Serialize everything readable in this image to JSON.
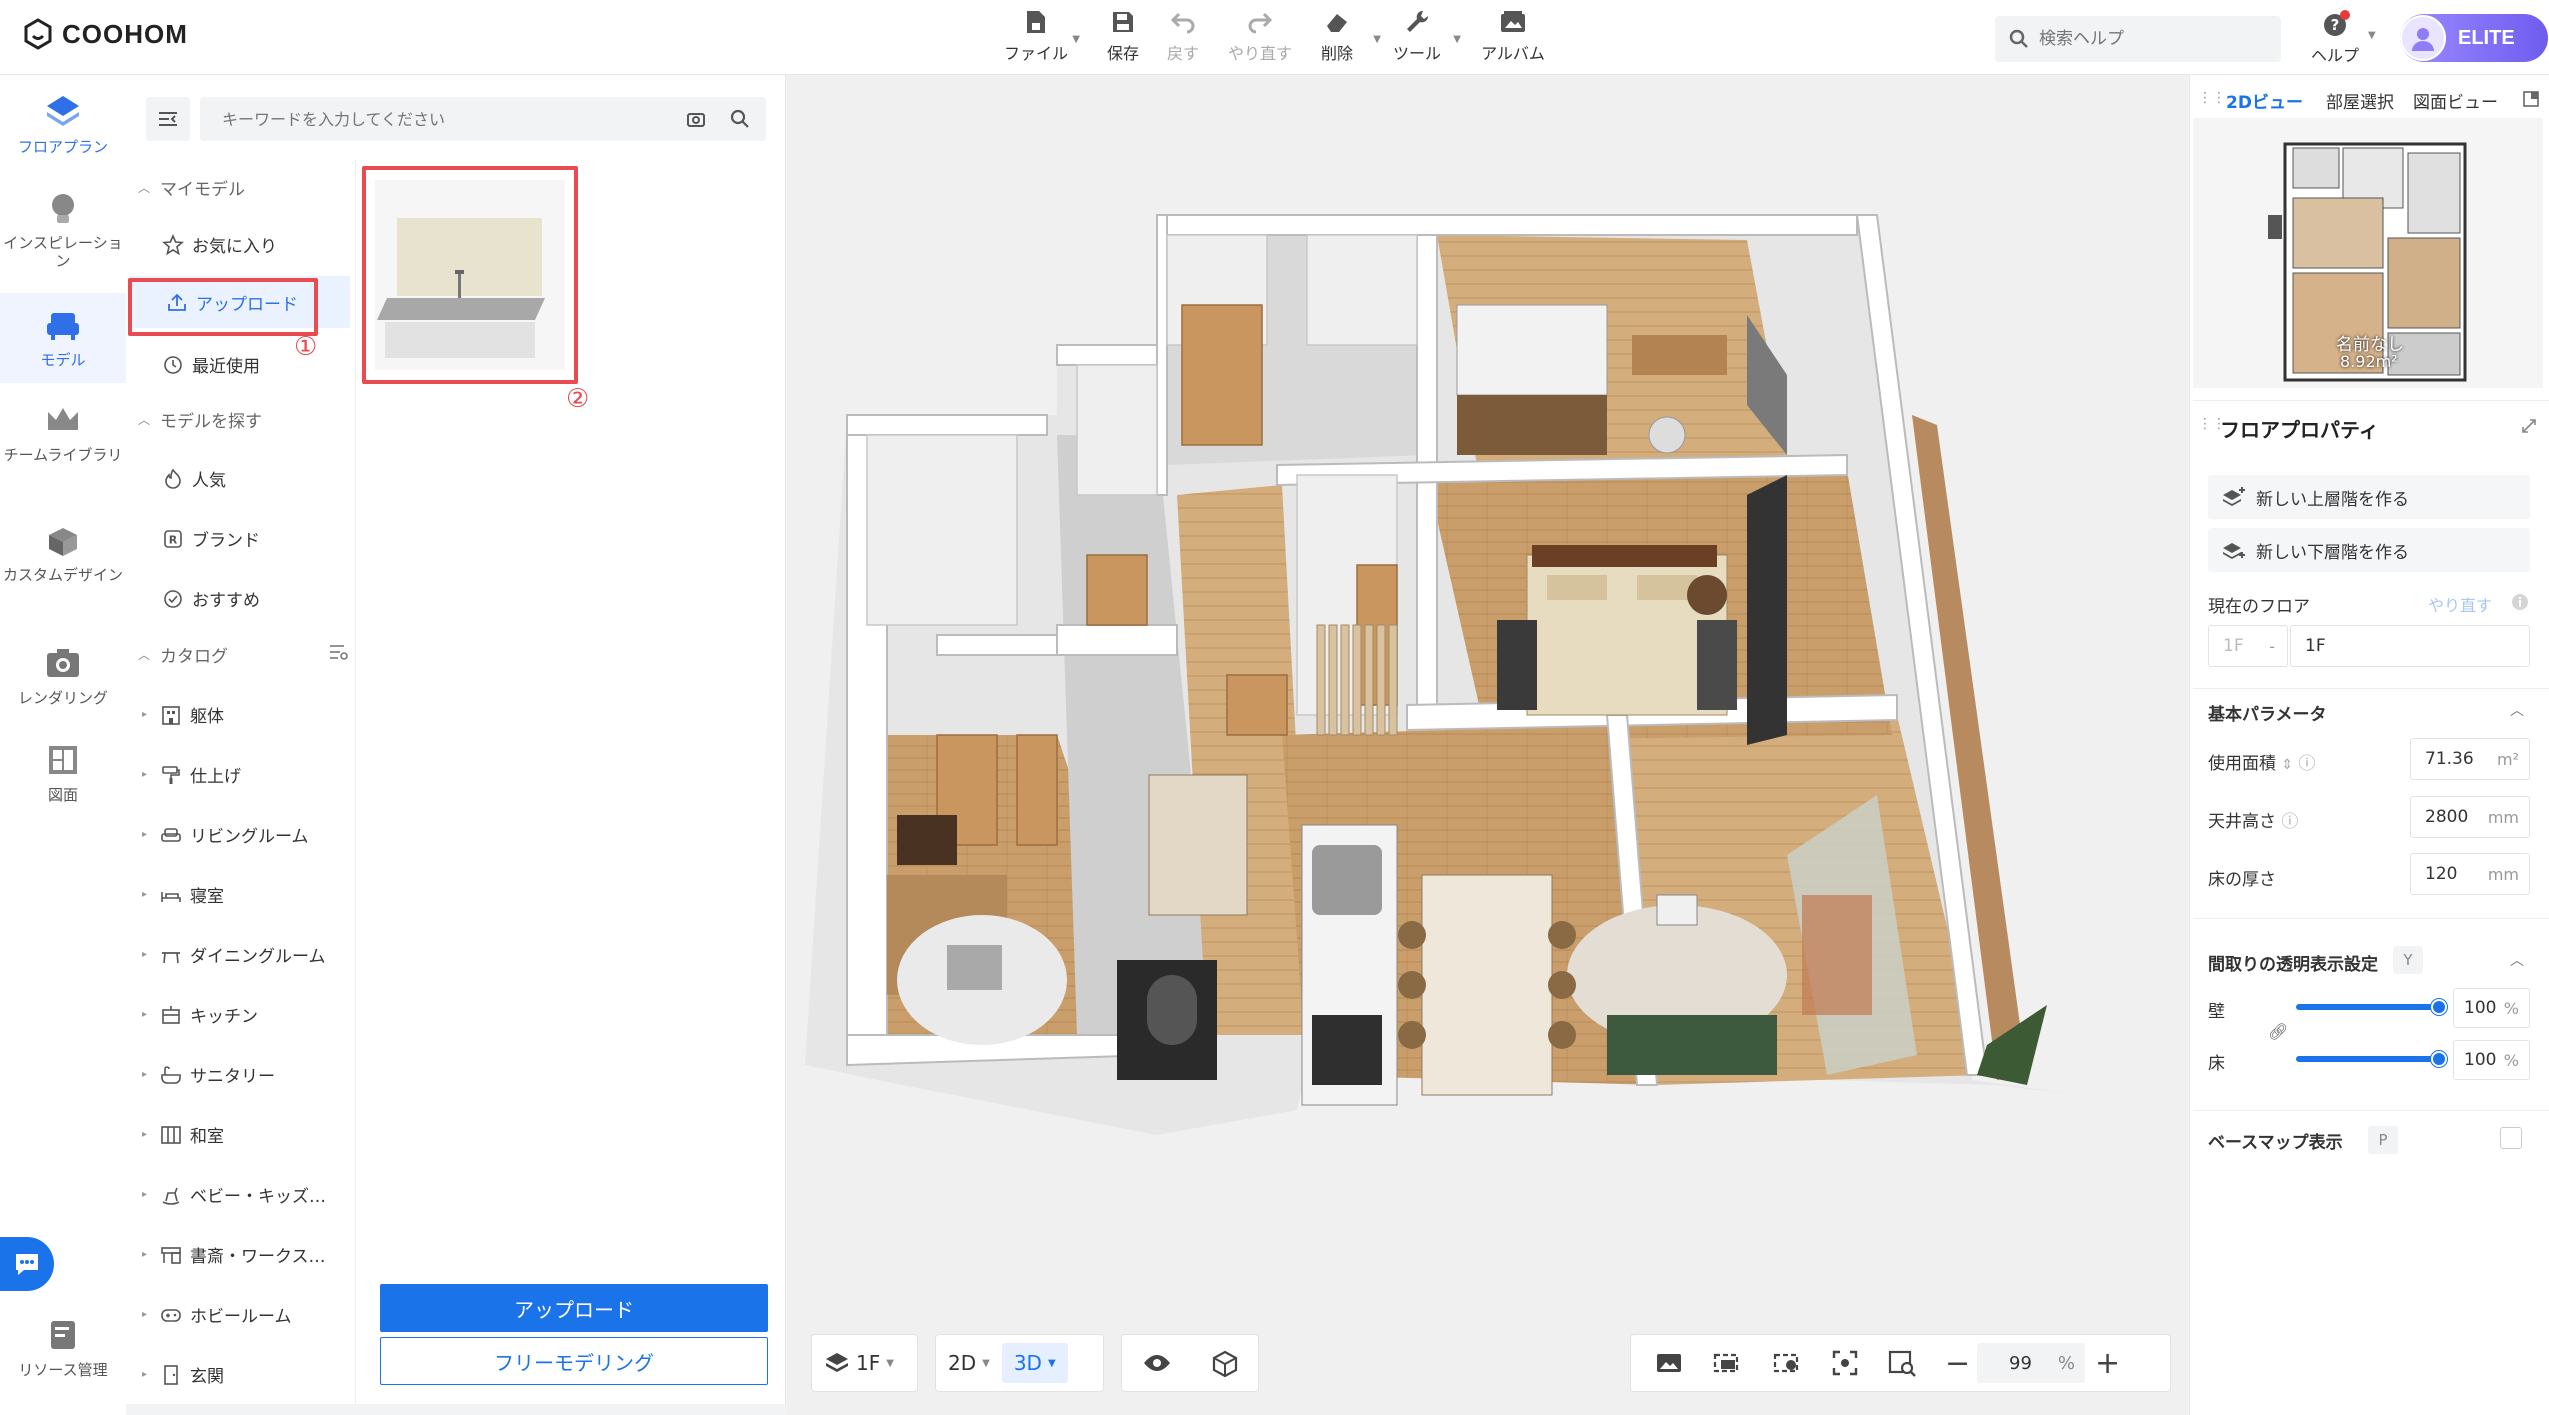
{
  "app": {
    "name": "COOHOM"
  },
  "toolbar": {
    "items": [
      {
        "label": "ファイル",
        "icon": "file-icon"
      },
      {
        "label": "保存",
        "icon": "save-icon"
      },
      {
        "label": "戻す",
        "icon": "undo-icon",
        "disabled": true
      },
      {
        "label": "やり直す",
        "icon": "redo-icon",
        "disabled": true
      },
      {
        "label": "削除",
        "icon": "eraser-icon"
      },
      {
        "label": "ツール",
        "icon": "wrench-icon"
      },
      {
        "label": "アルバム",
        "icon": "album-icon"
      }
    ],
    "search_placeholder": "検索ヘルプ",
    "help_label": "ヘルプ",
    "plan_badge": "ELITE"
  },
  "rail": {
    "items": [
      {
        "label": "フロアプラン",
        "active": false
      },
      {
        "label": "インスピレーション",
        "active": false
      },
      {
        "label": "モデル",
        "active": true
      },
      {
        "label": "チームライブラリ",
        "active": false
      },
      {
        "label": "カスタムデザイン",
        "active": false
      },
      {
        "label": "レンダリング",
        "active": false
      },
      {
        "label": "図面",
        "active": false
      },
      {
        "label": "リソース管理",
        "active": false
      }
    ]
  },
  "model_panel": {
    "search_placeholder": "キーワードを入力してください",
    "sections": {
      "my_models": "マイモデル",
      "explore": "モデルを探す",
      "catalog": "カタログ"
    },
    "my_models": [
      "お気に入り",
      "アップロード",
      "最近使用"
    ],
    "explore": [
      "人気",
      "ブランド",
      "おすすめ"
    ],
    "catalog": [
      "躯体",
      "仕上げ",
      "リビングルーム",
      "寝室",
      "ダイニングルーム",
      "キッチン",
      "サニタリー",
      "和室",
      "ベビー・キッズ…",
      "書斎・ワークス…",
      "ホビールーム",
      "玄関"
    ],
    "selected": "アップロード",
    "annotations": [
      "①",
      "②"
    ],
    "upload_button": "アップロード",
    "free_modeling_button": "フリーモデリング"
  },
  "canvas": {
    "floor_selector": "1F",
    "view_2d": "2D",
    "view_3d": "3D",
    "zoom": "99",
    "zoom_unit": "%"
  },
  "right_panel": {
    "tabs": [
      "2Dビュー",
      "部屋選択",
      "図面ビュー"
    ],
    "active_tab": "2Dビュー",
    "minimap_room_name": "名前なし",
    "minimap_room_area": "8.92m²",
    "title": "フロアプロパティ",
    "new_upper": "新しい上層階を作る",
    "new_lower": "新しい下層階を作る",
    "current_floor_label": "現在のフロア",
    "redo_label": "やり直す",
    "floor_prefix": "1F",
    "floor_name": "1F",
    "basic_params": "基本パラメータ",
    "area_label": "使用面積",
    "area_value": "71.36",
    "area_unit": "m²",
    "ceiling_label": "天井高さ",
    "ceiling_value": "2800",
    "ceiling_unit": "mm",
    "floor_thick_label": "床の厚さ",
    "floor_thick_value": "120",
    "floor_thick_unit": "mm",
    "transparency_label": "間取りの透明表示設定",
    "transparency_key": "Y",
    "wall_label": "壁",
    "wall_value": "100",
    "floor_label": "床",
    "floor_value": "100",
    "percent": "%",
    "basemap_label": "ベースマップ表示",
    "basemap_key": "P"
  }
}
